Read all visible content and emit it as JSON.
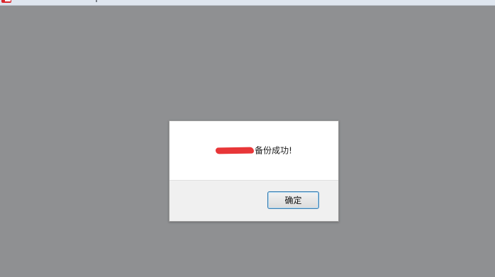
{
  "dialog": {
    "message": "备份成功!",
    "ok_label": "确定"
  },
  "colors": {
    "backdrop": "#8f9092",
    "redaction": "#e83638",
    "button_border": "#3c7fb1"
  }
}
